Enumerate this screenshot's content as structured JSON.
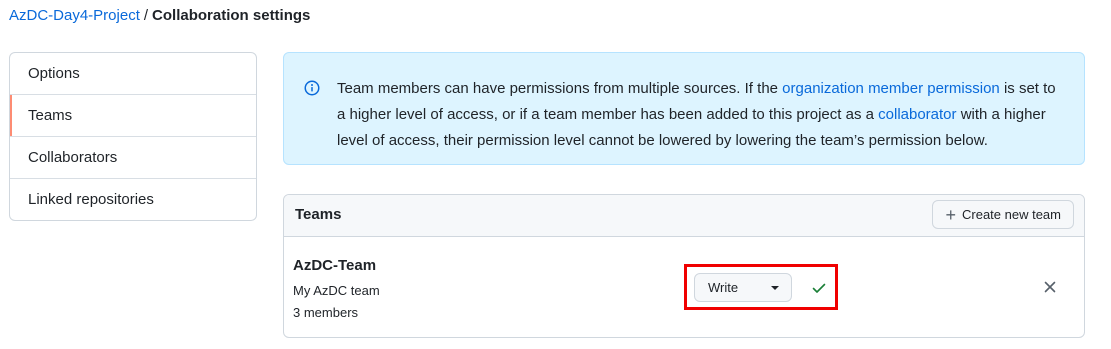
{
  "breadcrumb": {
    "project": "AzDC-Day4-Project",
    "separator": "/",
    "current": "Collaboration settings"
  },
  "sidebar": {
    "items": [
      {
        "label": "Options"
      },
      {
        "label": "Teams"
      },
      {
        "label": "Collaborators"
      },
      {
        "label": "Linked repositories"
      }
    ],
    "selected": "Teams"
  },
  "notice": {
    "icon": "info-icon",
    "text_1": "Team members can have permissions from multiple sources. If the ",
    "link_1": "organization member permission",
    "text_2": " is set to a higher level of access, or if a team member has been added to this project as a ",
    "link_2": "collaborator",
    "text_3": " with a higher level of access, their permission level cannot be lowered by lowering the team’s permission below."
  },
  "teams": {
    "title": "Teams",
    "new_team_label": "Create new team",
    "rows": [
      {
        "name": "AzDC-Team",
        "description": "My AzDC team",
        "members": "3 members",
        "permission": "Write",
        "saved_icon": "check-icon",
        "remove_icon": "x-icon"
      }
    ]
  },
  "colors": {
    "link": "#0969da",
    "notice_bg": "#ddf4ff",
    "selected_marker": "#fd8c73",
    "highlight": "#f00000",
    "success": "#1a7f37"
  }
}
